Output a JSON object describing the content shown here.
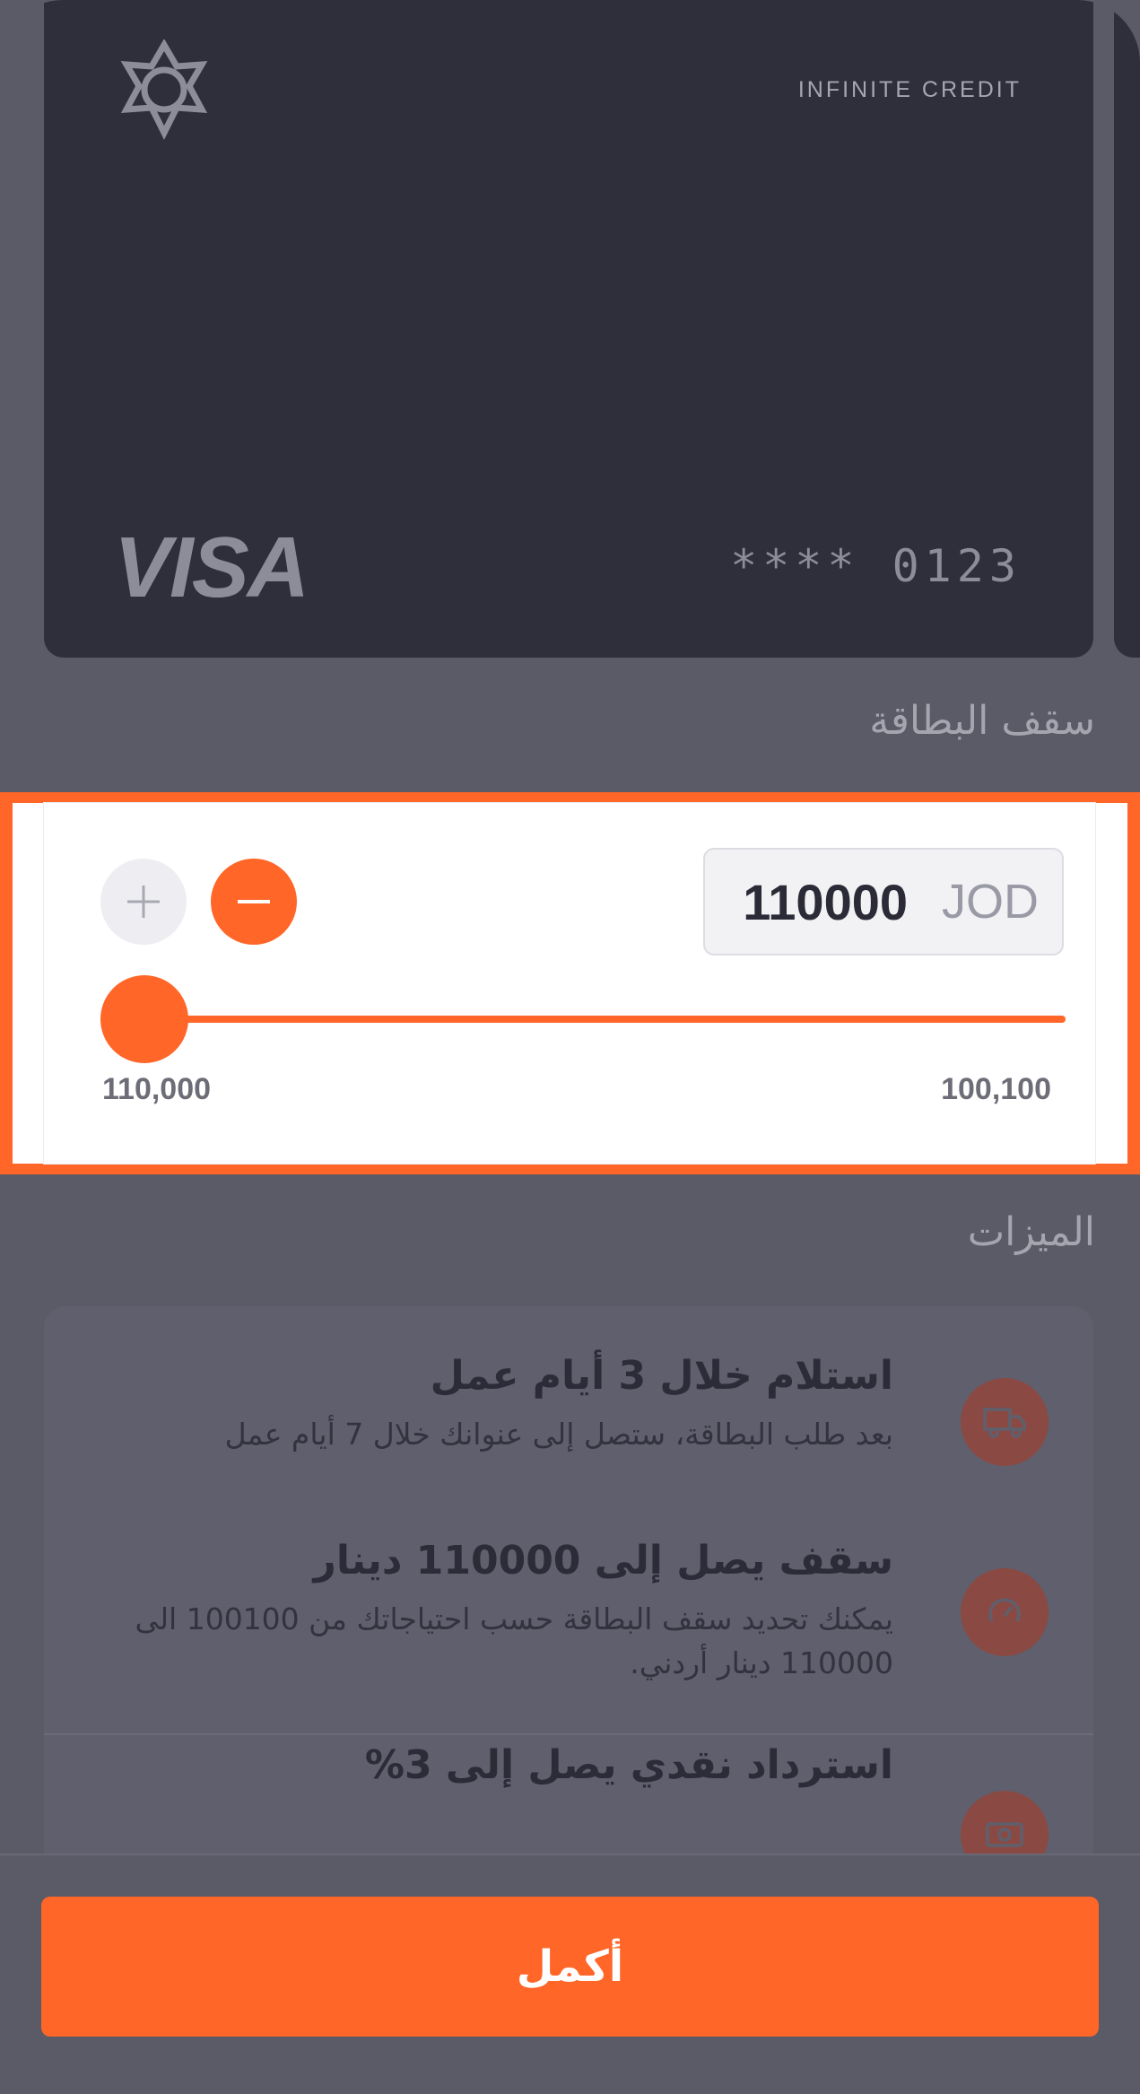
{
  "card": {
    "tier": "INFINITE CREDIT",
    "brand": "VISA",
    "number_masked": "**** 0123"
  },
  "limit_section": {
    "title": "سقف البطاقة",
    "amount": "110000",
    "currency": "JOD",
    "range_min_label": "110,000",
    "range_max_label": "100,100",
    "slider_fraction": 0,
    "accent_color": "#ff6628"
  },
  "features_section": {
    "title": "الميزات",
    "items": [
      {
        "icon": "truck-icon",
        "title": "استلام خلال 3 أيام عمل",
        "desc": "بعد طلب البطاقة، ستصل إلى عنوانك خلال 7 أيام عمل"
      },
      {
        "icon": "gauge-icon",
        "title": "سقف يصل إلى 110000 دينار",
        "desc": "يمكنك تحديد سقف البطاقة حسب احتياجاتك من 100100 الى 110000 دينار أردني."
      },
      {
        "icon": "cash-icon",
        "title": "استرداد نقدي يصل إلى 3%",
        "desc": ""
      }
    ]
  },
  "footer": {
    "continue_label": "أكمل"
  }
}
